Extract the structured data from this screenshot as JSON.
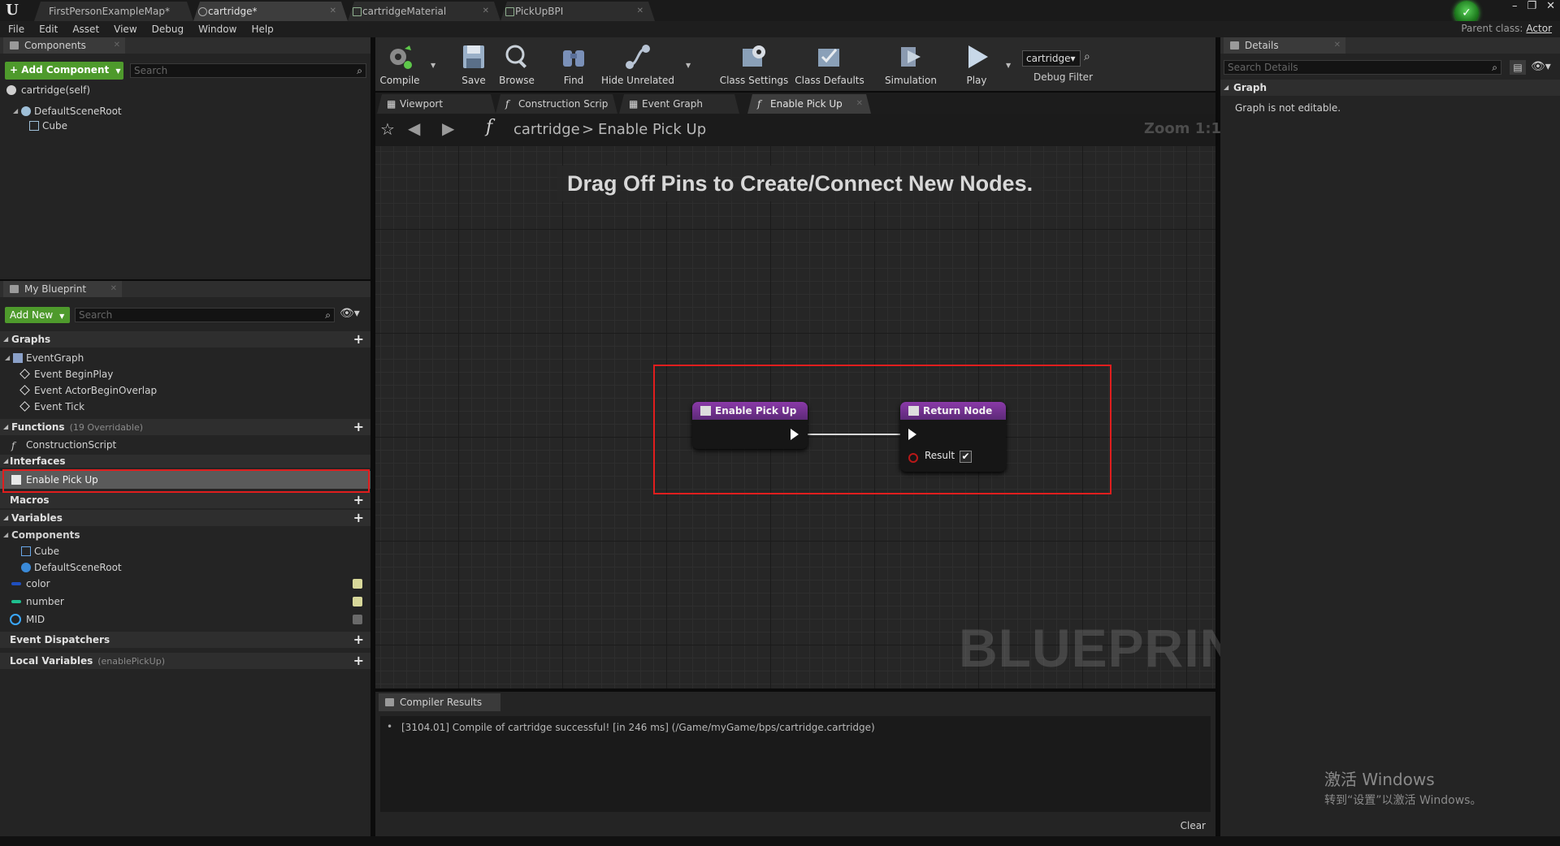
{
  "window": {
    "tabs": [
      {
        "label": "FirstPersonExampleMap*",
        "active": false
      },
      {
        "label": "cartridge*",
        "active": true
      },
      {
        "label": "cartridgeMaterial",
        "active": false
      },
      {
        "label": "PickUpBPI",
        "active": false
      }
    ],
    "controls": [
      "–",
      "❐",
      "✕"
    ]
  },
  "menu": [
    "File",
    "Edit",
    "Asset",
    "View",
    "Debug",
    "Window",
    "Help"
  ],
  "parent_class": {
    "label": "Parent class:",
    "value": "Actor"
  },
  "components_panel": {
    "tab": "Components",
    "add_button": "+ Add Component",
    "search_placeholder": "Search",
    "self_item": "cartridge(self)",
    "tree": [
      "DefaultSceneRoot",
      "Cube"
    ]
  },
  "my_blueprint": {
    "tab": "My Blueprint",
    "add_button": "Add New",
    "search_placeholder": "Search",
    "graphs": {
      "label": "Graphs",
      "items": [
        "EventGraph",
        "Event BeginPlay",
        "Event ActorBeginOverlap",
        "Event Tick"
      ]
    },
    "functions": {
      "label": "Functions",
      "sub": "(19 Overridable)",
      "items": [
        "ConstructionScript"
      ]
    },
    "interfaces": {
      "label": "Interfaces",
      "items": [
        "Enable Pick Up"
      ]
    },
    "macros": {
      "label": "Macros"
    },
    "variables": {
      "label": "Variables",
      "components_label": "Components",
      "components": [
        "Cube",
        "DefaultSceneRoot"
      ],
      "items": [
        {
          "name": "color",
          "color": "#1f4fbf"
        },
        {
          "name": "number",
          "color": "#1fbf8f"
        },
        {
          "name": "MID",
          "color": "#3aa8ff"
        }
      ]
    },
    "event_dispatchers": {
      "label": "Event Dispatchers"
    },
    "local_variables": {
      "label": "Local Variables",
      "sub": "(enablePickUp)"
    }
  },
  "toolbar": {
    "buttons": [
      "Compile",
      "Save",
      "Browse",
      "Find",
      "Hide Unrelated",
      "Class Settings",
      "Class Defaults",
      "Simulation",
      "Play"
    ],
    "debug_select": "cartridge▾",
    "debug_filter": "Debug Filter"
  },
  "graph_tabs": [
    {
      "label": "Viewport",
      "active": false
    },
    {
      "label": "Construction Scrip",
      "active": false
    },
    {
      "label": "Event Graph",
      "active": false
    },
    {
      "label": "Enable Pick Up",
      "active": true
    }
  ],
  "graph": {
    "breadcrumb_root": "cartridge",
    "breadcrumb_sep": ">",
    "breadcrumb_leaf": "Enable Pick Up",
    "zoom": "Zoom 1:1",
    "hint": "Drag Off Pins to Create/Connect New Nodes.",
    "watermark": "BLUEPRINT",
    "nodes": {
      "entry": {
        "title": "Enable Pick Up"
      },
      "return": {
        "title": "Return Node",
        "pin_label": "Result",
        "checked": true
      }
    }
  },
  "compiler": {
    "tab": "Compiler Results",
    "message": "[3104.01] Compile of cartridge successful! [in 246 ms] (/Game/myGame/bps/cartridge.cartridge)",
    "clear": "Clear"
  },
  "details": {
    "tab": "Details",
    "search_placeholder": "Search Details",
    "section": "Graph",
    "message": "Graph is not editable."
  },
  "os_overlay": {
    "line1": "激活 Windows",
    "line2": "转到“设置”以激活 Windows。"
  },
  "colors": {
    "accent_green": "#4e9a2c",
    "node_purple": "#7a3596",
    "highlight_red": "#e01e1e"
  }
}
